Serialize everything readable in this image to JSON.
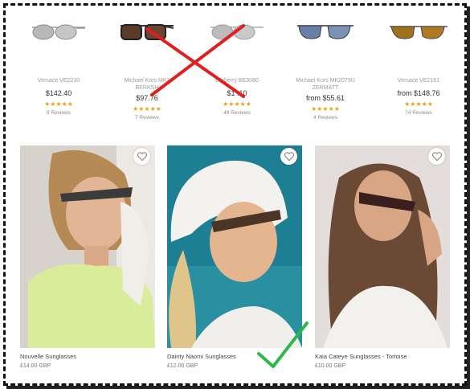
{
  "top_products": [
    {
      "name": "Versace VE2210",
      "price": "$142.40",
      "stars": "★★★★★",
      "reviews": "9 Reviews"
    },
    {
      "name": "Michael Kors MK2",
      "name2": "BERKSH",
      "price": "$97.76",
      "stars": "★★★★★",
      "reviews": "7 Reviews"
    },
    {
      "name": "Burberry BE3080",
      "price": "$1 .10",
      "stars": "★★★★★",
      "reviews": "49 Reviews"
    },
    {
      "name": "Michael Kors MK2079U",
      "name2": "ZERMATT",
      "price": "from $55.61",
      "stars": "★★★★★",
      "reviews": "4 Reviews"
    },
    {
      "name": "Versace VE2161",
      "price": "from $148.76",
      "stars": "★★★★★",
      "reviews": "74 Reviews"
    }
  ],
  "photo_products": [
    {
      "title": "Nouvelle Sunglasses",
      "price": "£14.00 GBP"
    },
    {
      "title": "Dainty Naomi Sunglasses",
      "price": "£12.00 GBP"
    },
    {
      "title": "Kaia Cateye Sunglasses - Tortoise",
      "price": "£10.00 GBP"
    }
  ],
  "icons": {
    "heart": "heart-icon",
    "red_x": "cross-mark-icon",
    "check": "check-mark-icon"
  },
  "colors": {
    "star": "#e8a21a",
    "cross": "#e02020",
    "check": "#2fb84a"
  }
}
